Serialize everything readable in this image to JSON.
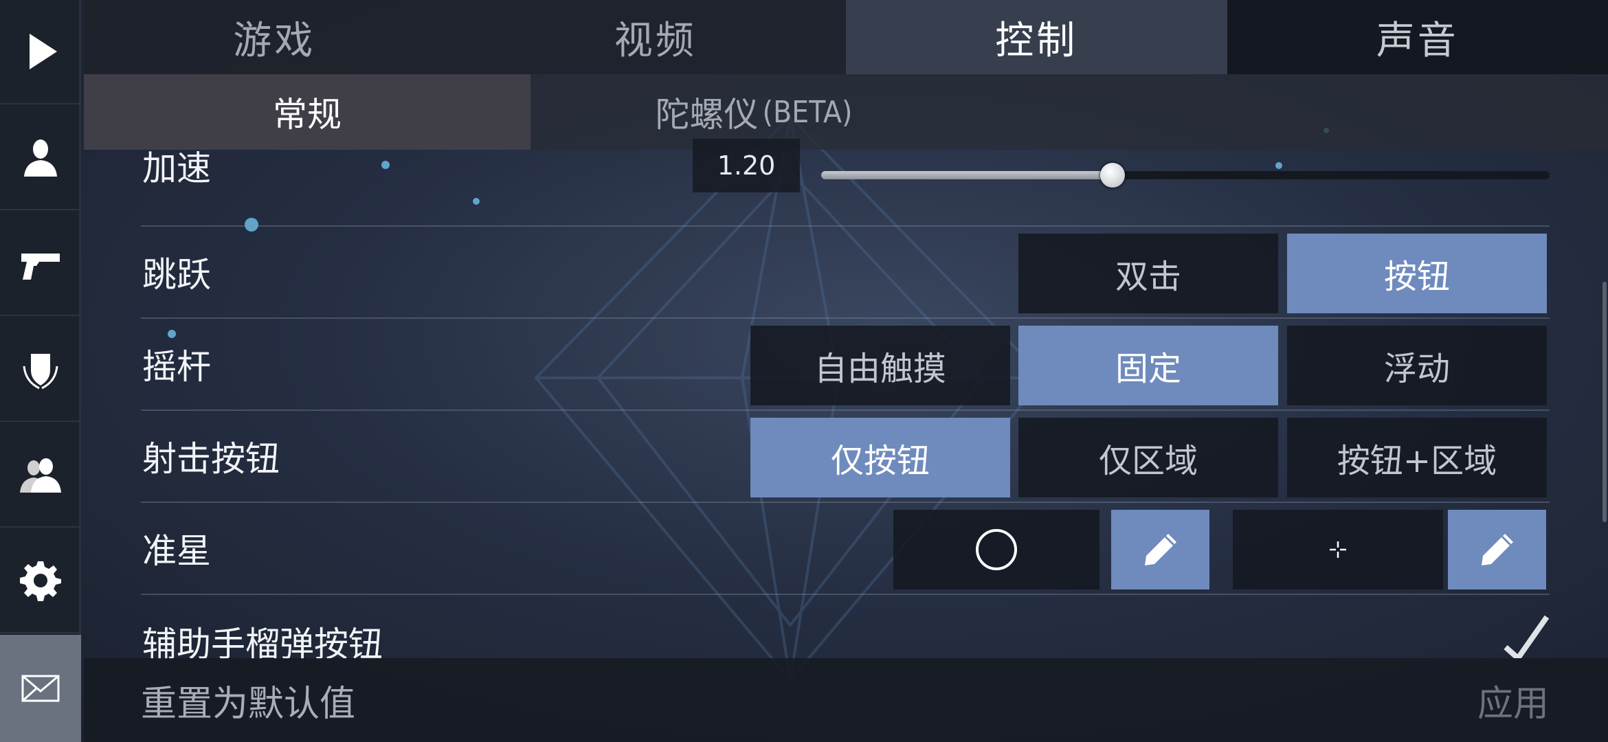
{
  "sidebar": {
    "items": [
      {
        "icon": "play-icon"
      },
      {
        "icon": "profile-icon"
      },
      {
        "icon": "pistol-icon"
      },
      {
        "icon": "clan-shield-icon"
      },
      {
        "icon": "friends-icon"
      },
      {
        "icon": "gear-icon"
      },
      {
        "icon": "mail-icon",
        "active": true
      }
    ]
  },
  "top_tabs": [
    {
      "label": "游戏"
    },
    {
      "label": "视频"
    },
    {
      "label": "控制",
      "active": true
    },
    {
      "label": "声音"
    }
  ],
  "sub_tabs": [
    {
      "label": "常规",
      "active": true
    },
    {
      "label": "陀螺仪",
      "suffix": "(BETA)"
    }
  ],
  "settings": {
    "acceleration": {
      "label": "加速",
      "value": "1.20",
      "slider_fraction": 0.4
    },
    "jump": {
      "label": "跳跃",
      "options": [
        "双击",
        "按钮"
      ],
      "selected": "按钮"
    },
    "joystick": {
      "label": "摇杆",
      "options": [
        "自由触摸",
        "固定",
        "浮动"
      ],
      "selected": "固定"
    },
    "fire_button": {
      "label": "射击按钮",
      "options": [
        "仅按钮",
        "仅区域",
        "按钮+区域"
      ],
      "selected": "仅按钮"
    },
    "crosshair": {
      "label": "准星"
    },
    "grenade_button": {
      "label": "辅助手榴弹按钮",
      "checked": true
    }
  },
  "bottom": {
    "reset_label": "重置为默认值",
    "apply_label": "应用"
  },
  "colors": {
    "accent": "#6f8bbd",
    "sidebar_bg": "#1c222c"
  }
}
